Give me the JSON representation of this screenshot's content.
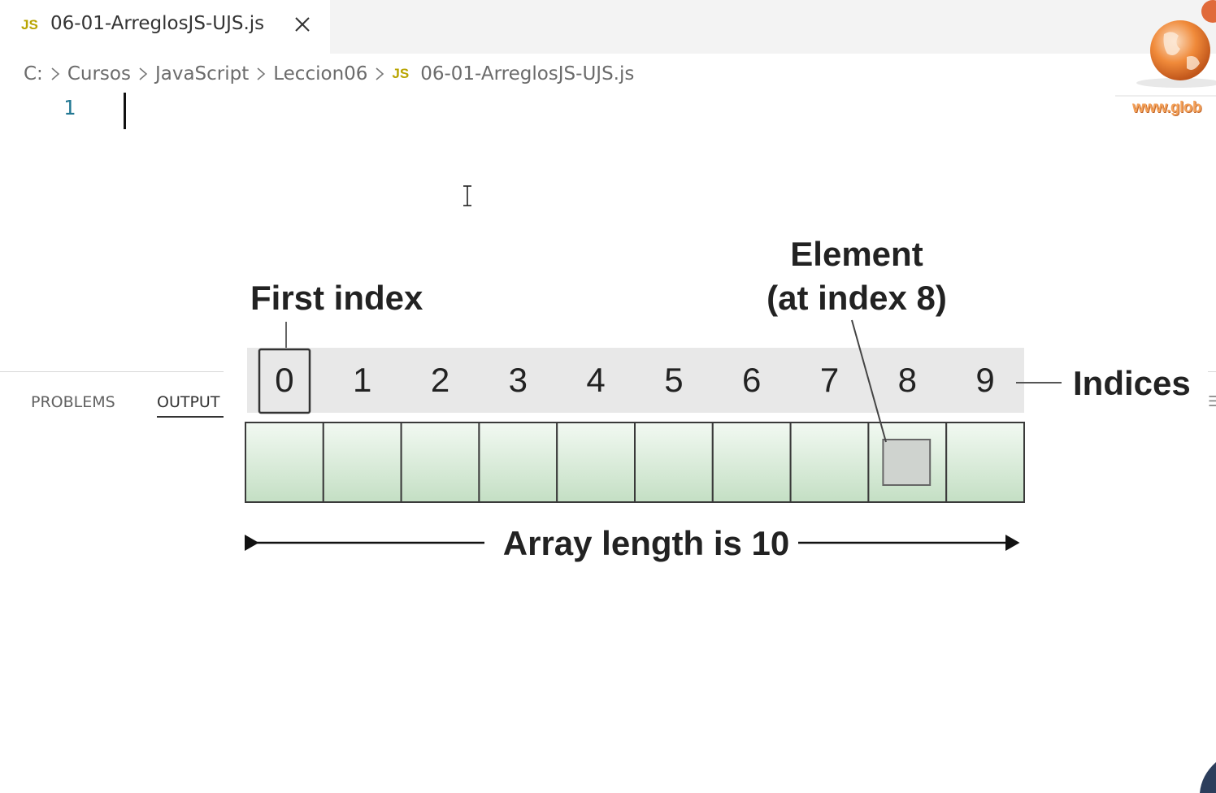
{
  "editor": {
    "tab": {
      "badge": "JS",
      "title": "06-01-ArreglosJS-UJS.js"
    },
    "breadcrumb": [
      "C:",
      "Cursos",
      "JavaScript",
      "Leccion06"
    ],
    "breadcrumb_file": {
      "badge": "JS",
      "name": "06-01-ArreglosJS-UJS.js"
    },
    "line_number": "1",
    "code": ""
  },
  "panel": {
    "tabs": [
      {
        "label": "PROBLEMS",
        "active": false
      },
      {
        "label": "OUTPUT",
        "active": true
      }
    ]
  },
  "logo": {
    "text": "www.glob"
  },
  "diagram": {
    "first_index_label": "First index",
    "element_label_line1": "Element",
    "element_label_line2": "(at index 8)",
    "indices": [
      "0",
      "1",
      "2",
      "3",
      "4",
      "5",
      "6",
      "7",
      "8",
      "9"
    ],
    "indices_label": "Indices",
    "length_label": "Array length is 10",
    "highlighted_index": 8,
    "cell_count": 10
  },
  "colors": {
    "cell_fill": "#ddeedd",
    "index_band": "#e8e8e8",
    "line_number": "#237893",
    "js_badge": "#b8a400"
  }
}
